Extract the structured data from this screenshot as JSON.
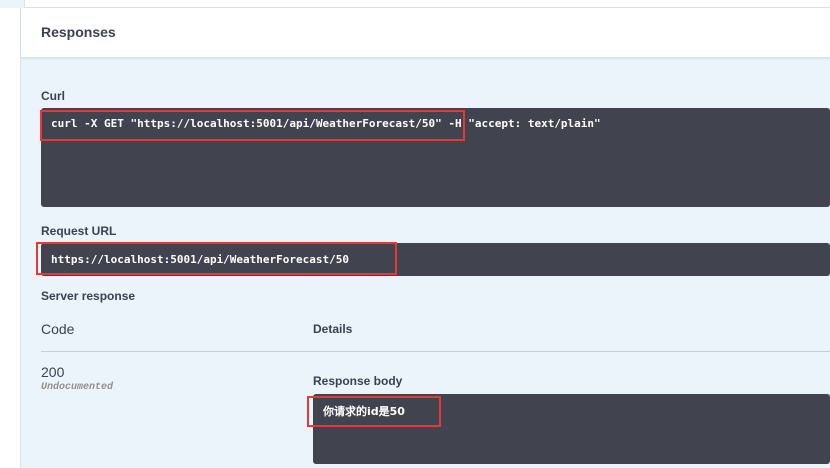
{
  "responses": {
    "title": "Responses"
  },
  "curl": {
    "label": "Curl",
    "command": "curl -X GET \"https://localhost:5001/api/WeatherForecast/50\" -H \"accept: text/plain\""
  },
  "request_url": {
    "label": "Request URL",
    "value": "https://localhost:5001/api/WeatherForecast/50"
  },
  "server_response": {
    "label": "Server response",
    "code_header": "Code",
    "details_header": "Details",
    "rows": [
      {
        "code": "200",
        "status_note": "Undocumented",
        "body_label": "Response body",
        "body": "你请求的id是50"
      }
    ]
  },
  "colors": {
    "code_bg": "#41444e",
    "panel_bg": "#ebf3fb",
    "highlight": "#e53935"
  }
}
